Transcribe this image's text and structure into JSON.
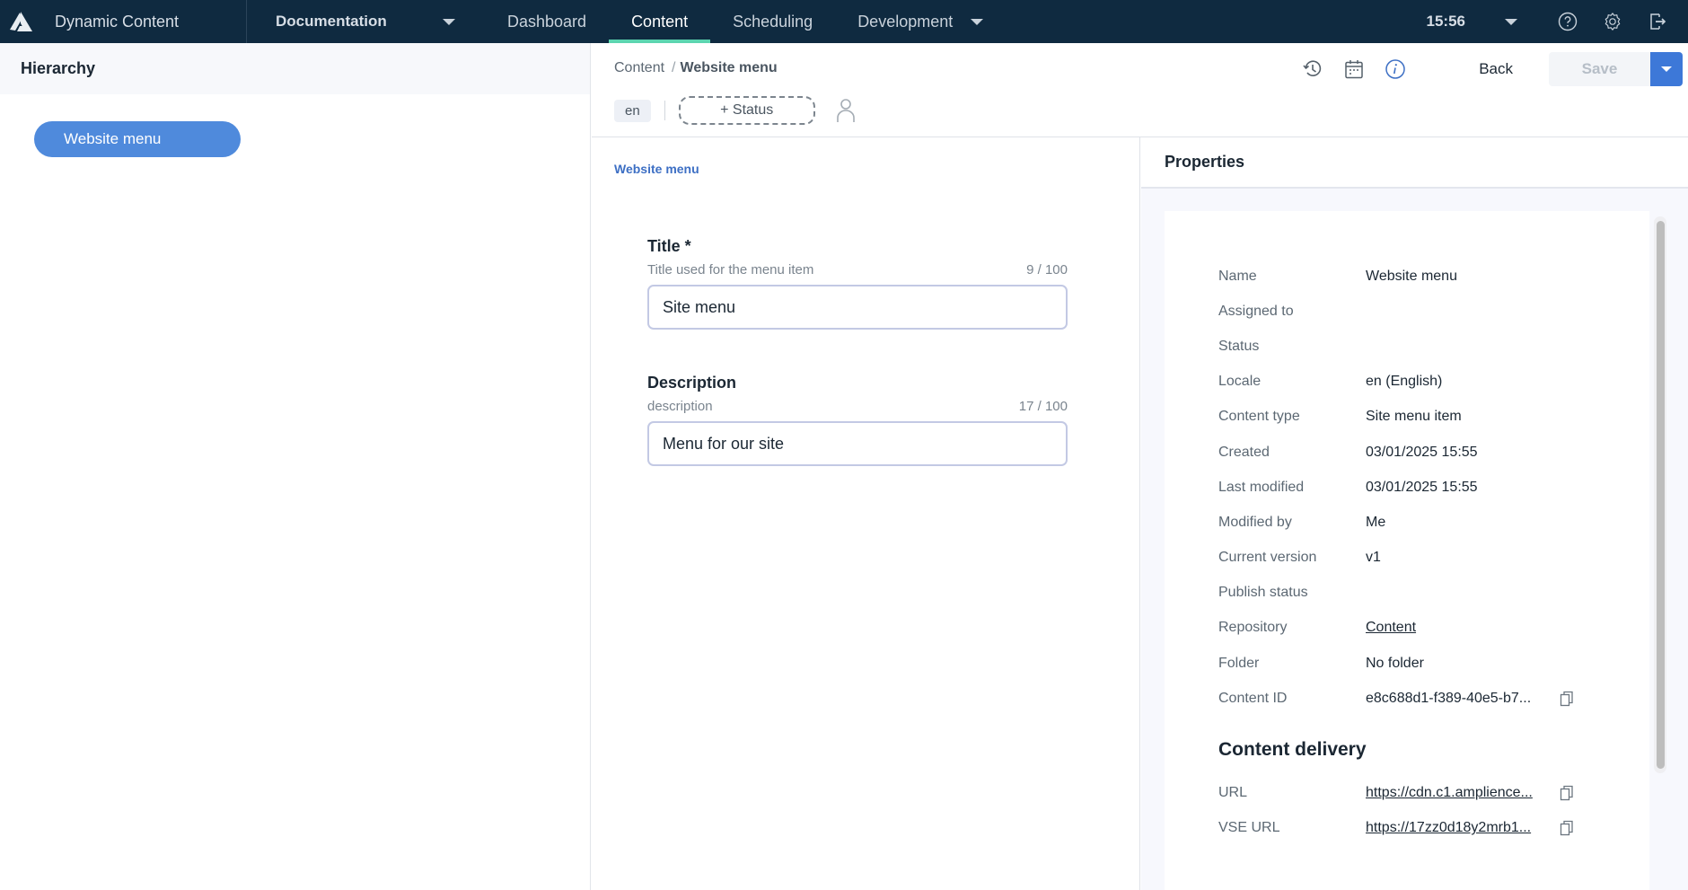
{
  "app": {
    "title": "Dynamic Content",
    "hub": "Documentation",
    "nav": [
      {
        "label": "Dashboard",
        "active": false
      },
      {
        "label": "Content",
        "active": true
      },
      {
        "label": "Scheduling",
        "active": false
      },
      {
        "label": "Development",
        "active": false
      }
    ],
    "clock": "15:56",
    "icons": [
      "help-icon",
      "settings-icon",
      "logout-icon"
    ]
  },
  "hierarchy": {
    "title": "Hierarchy",
    "items": [
      {
        "label": "Website menu",
        "selected": true
      }
    ]
  },
  "editor": {
    "breadcrumb": {
      "root": "Content",
      "separator": "/",
      "current": "Website menu"
    },
    "locale": "en",
    "status_button": "+ Status",
    "back_label": "Back",
    "save_label": "Save",
    "form_breadcrumb": "Website menu",
    "fields": [
      {
        "label": "Title *",
        "help": "Title used for the menu item",
        "count": "9 / 100",
        "value": "Site menu"
      },
      {
        "label": "Description",
        "help": "description",
        "count": "17 / 100",
        "value": "Menu for our site"
      }
    ]
  },
  "properties": {
    "title": "Properties",
    "rows": [
      {
        "key": "Name",
        "value": "Website menu"
      },
      {
        "key": "Assigned to",
        "value": ""
      },
      {
        "key": "Status",
        "value": ""
      },
      {
        "key": "Locale",
        "value": "en (English)"
      },
      {
        "key": "Content type",
        "value": "Site menu item"
      },
      {
        "key": "Created",
        "value": "03/01/2025 15:55"
      },
      {
        "key": "Last modified",
        "value": "03/01/2025 15:55"
      },
      {
        "key": "Modified by",
        "value": "Me"
      },
      {
        "key": "Current version",
        "value": "v1"
      },
      {
        "key": "Publish status",
        "value": ""
      },
      {
        "key": "Repository",
        "value": "Content"
      },
      {
        "key": "Folder",
        "value": "No folder"
      },
      {
        "key": "Content ID",
        "value": "e8c688d1-f389-40e5-b7..."
      }
    ],
    "delivery_title": "Content delivery",
    "delivery": [
      {
        "key": "URL",
        "value": "https://cdn.c1.amplience..."
      },
      {
        "key": "VSE URL",
        "value": "https://17zz0d18y2mrb1..."
      }
    ]
  },
  "colors": {
    "nav_bg": "#0f2a40",
    "active_tab_underline": "#5cd5b0",
    "accent": "#3d78d8",
    "tree_pill": "#4f8adc"
  }
}
